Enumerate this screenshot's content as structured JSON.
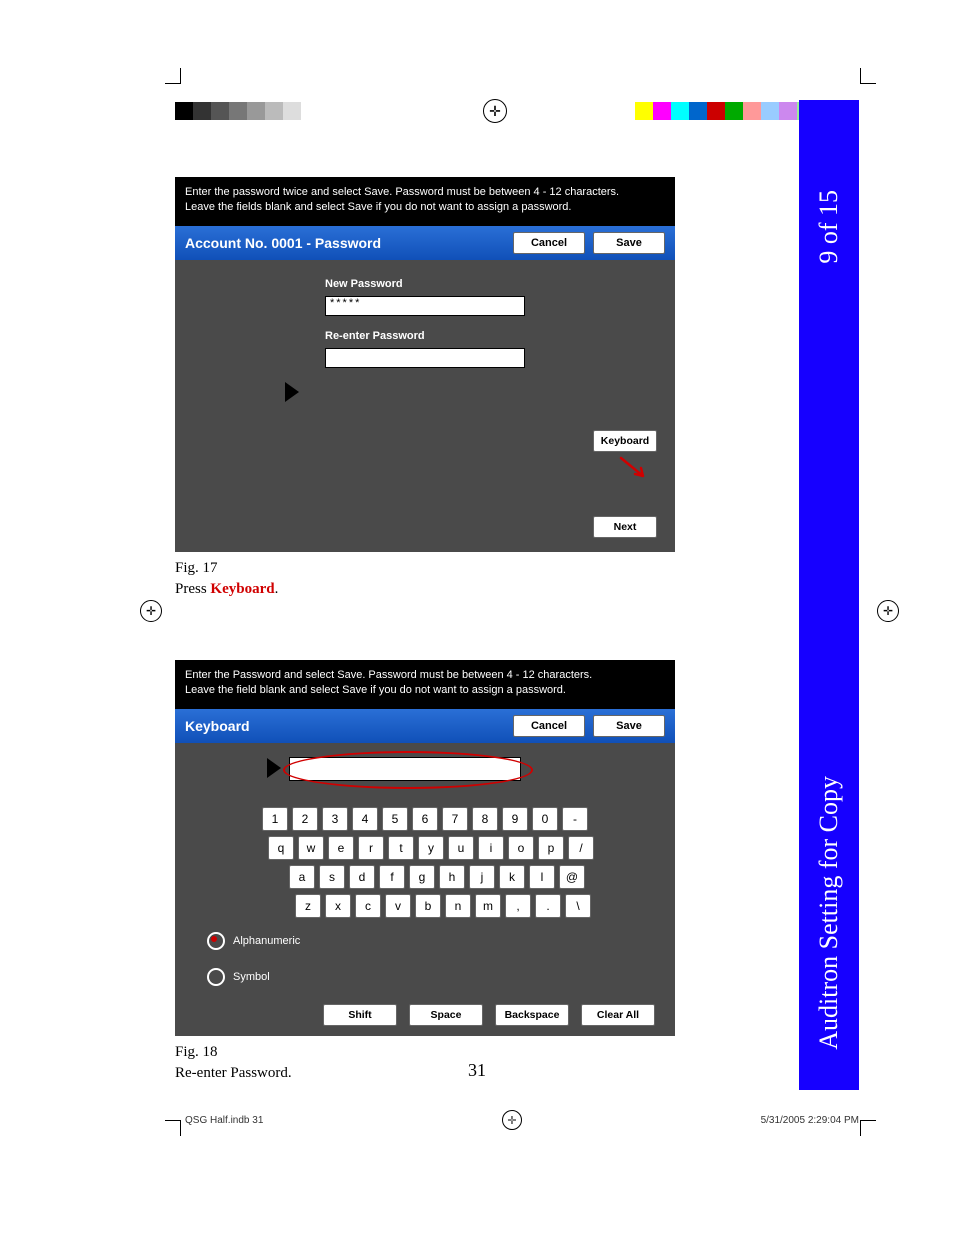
{
  "regColorsLeft": [
    "#000",
    "#333",
    "#555",
    "#777",
    "#999",
    "#bbb",
    "#ddd",
    "#fff",
    "#fff",
    "#fff"
  ],
  "regColorsRight": [
    "#ff0",
    "#f0f",
    "#0ff",
    "#06c",
    "#c00",
    "#0a0",
    "#f99",
    "#9cf",
    "#c8e",
    "#9e9"
  ],
  "fig17": {
    "instr1": "Enter the password twice and select Save. Password must be between 4 - 12 characters.",
    "instr2": "Leave the fields blank and select Save if you do not want to assign a password.",
    "title": "Account No. 0001 - Password",
    "cancel": "Cancel",
    "save": "Save",
    "newPw": "New Password",
    "rePw": "Re-enter Password",
    "pwVal": "*****",
    "keyboard": "Keyboard",
    "next": "Next",
    "caption": "Fig. 17",
    "note1": "Press ",
    "note2": "Keyboard",
    "note3": "."
  },
  "fig18": {
    "instr1": "Enter the Password and select Save. Password must be between 4 - 12 characters.",
    "instr2": "Leave the field blank and select Save if you do not want to assign a password.",
    "title": "Keyboard",
    "cancel": "Cancel",
    "save": "Save",
    "row1": [
      "1",
      "2",
      "3",
      "4",
      "5",
      "6",
      "7",
      "8",
      "9",
      "0",
      "-"
    ],
    "row2": [
      "q",
      "w",
      "e",
      "r",
      "t",
      "y",
      "u",
      "i",
      "o",
      "p",
      "/"
    ],
    "row3": [
      "a",
      "s",
      "d",
      "f",
      "g",
      "h",
      "j",
      "k",
      "l",
      "@"
    ],
    "row4": [
      "z",
      "x",
      "c",
      "v",
      "b",
      "n",
      "m",
      ",",
      ".",
      "\\"
    ],
    "alpha": "Alphanumeric",
    "symbol": "Symbol",
    "shift": "Shift",
    "space": "Space",
    "back": "Backspace",
    "clear": "Clear All",
    "caption": "Fig. 18",
    "note": "Re-enter Password."
  },
  "tab": {
    "page": "9 of 15",
    "section": "Auditron Setting for Copy"
  },
  "pageNum": "31",
  "footer": {
    "left": "QSG Half.indb   31",
    "right": "5/31/2005   2:29:04 PM"
  }
}
